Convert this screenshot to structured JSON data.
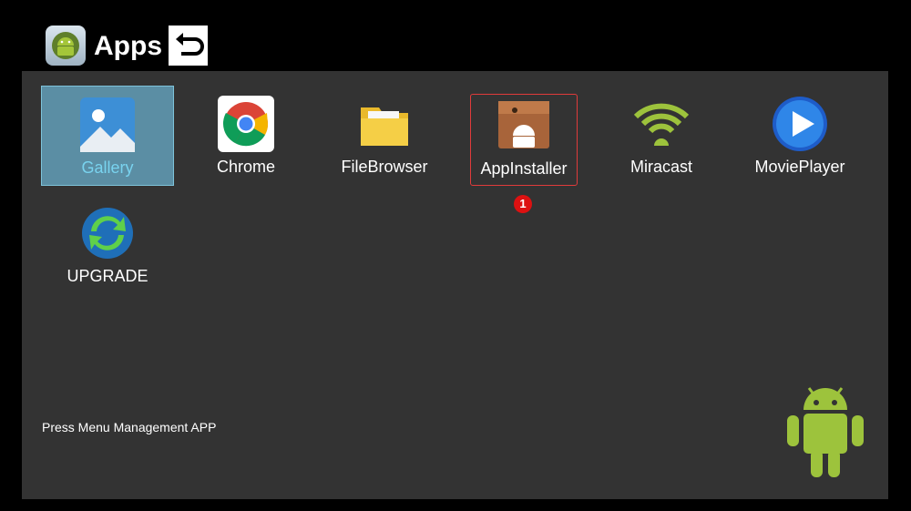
{
  "header": {
    "title": "Apps",
    "logo_icon": "android-icon",
    "back_icon": "back-arrow-icon"
  },
  "apps": [
    {
      "label": "Gallery",
      "icon": "gallery-icon",
      "state": "selected"
    },
    {
      "label": "Chrome",
      "icon": "chrome-icon",
      "state": "normal"
    },
    {
      "label": "FileBrowser",
      "icon": "folder-icon",
      "state": "normal"
    },
    {
      "label": "AppInstaller",
      "icon": "app-installer-icon",
      "state": "focused"
    },
    {
      "label": "Miracast",
      "icon": "miracast-icon",
      "state": "normal"
    },
    {
      "label": "MoviePlayer",
      "icon": "movie-player-icon",
      "state": "normal"
    },
    {
      "label": "UPGRADE",
      "icon": "upgrade-icon",
      "state": "normal"
    }
  ],
  "badge": {
    "count": "1"
  },
  "footer": {
    "hint": "Press Menu Management APP"
  },
  "colors": {
    "panel_bg": "#333333",
    "selected_bg": "#5b8ea4",
    "selected_label": "#79d3ef",
    "focus_border": "#e03b3b",
    "android_green": "#9dc33c"
  }
}
